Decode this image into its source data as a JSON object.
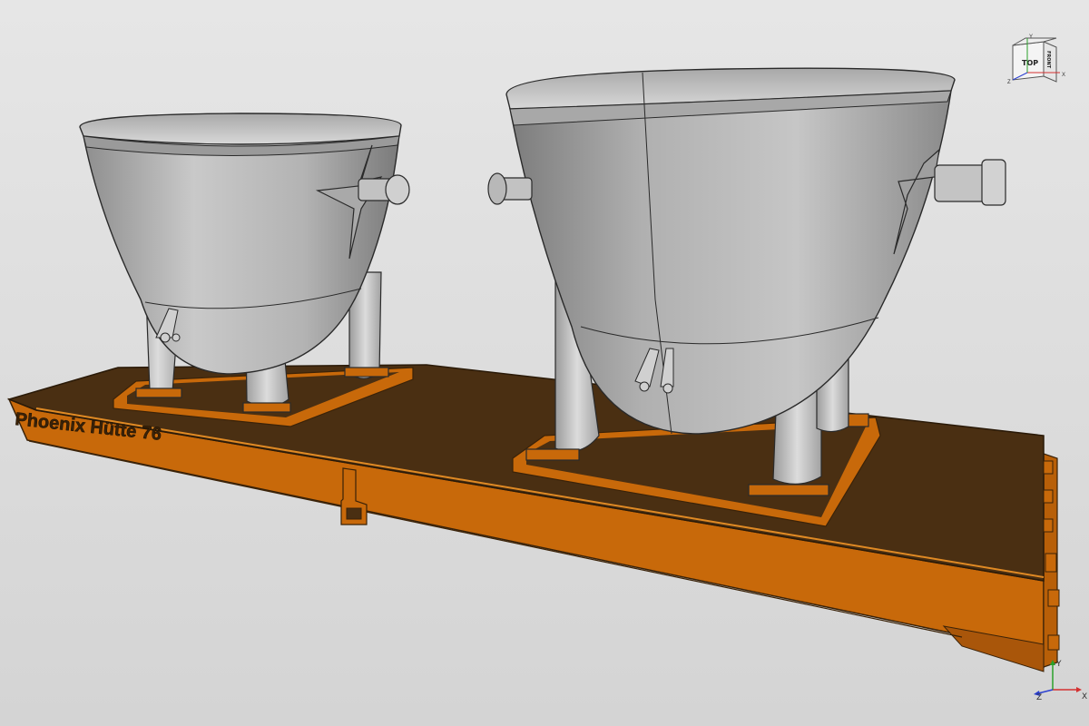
{
  "model": {
    "wagon_text": "Phoenix Hütte 76"
  },
  "navigation_cube": {
    "top_face": "TOP",
    "right_face": "FRONT",
    "axes": {
      "x": "X",
      "y": "Y",
      "z": "Z"
    }
  },
  "axis_triad": {
    "x": "X",
    "y": "Y",
    "z": "Z"
  },
  "colors": {
    "background": "#dcdcdc",
    "deck": "#4a2f12",
    "wagon_orange": "#c8690a",
    "wagon_orange_light": "#e08a24",
    "ladle_grey": "#b9b9b9",
    "axis_x": "#d43030",
    "axis_y": "#2aa02a",
    "axis_z": "#2a3fd0"
  }
}
